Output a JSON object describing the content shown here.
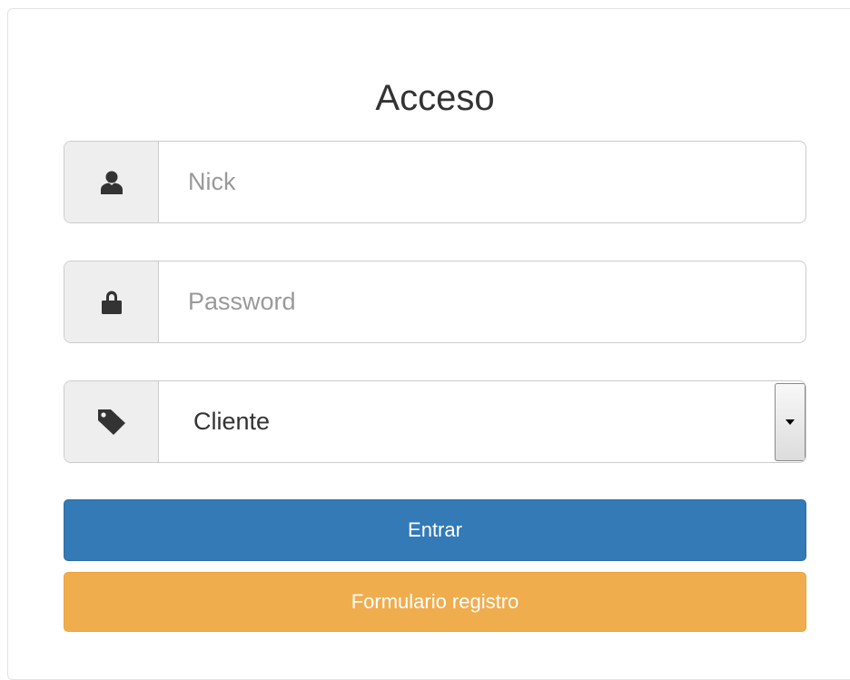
{
  "form": {
    "title": "Acceso",
    "nick_placeholder": "Nick",
    "password_placeholder": "Password",
    "role_selected": "Cliente",
    "submit_label": "Entrar",
    "register_label": "Formulario registro"
  },
  "icons": {
    "nick": "user-icon",
    "password": "lock-icon",
    "role": "tag-icon",
    "select_arrow": "caret-down-icon"
  },
  "colors": {
    "primary": "#337ab7",
    "warning": "#f0ad4e",
    "addon_bg": "#eeeeee"
  }
}
